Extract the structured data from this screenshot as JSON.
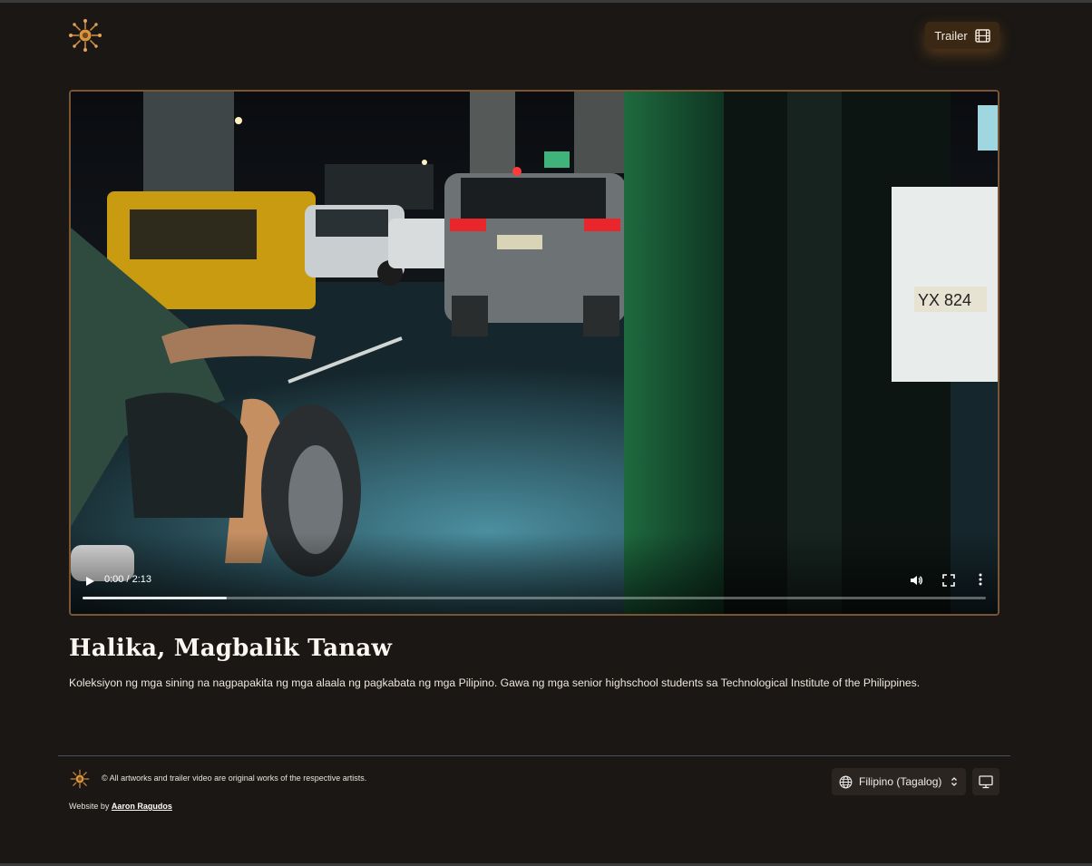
{
  "header": {
    "trailer_label": "Trailer",
    "icons": {
      "logo": "sun-logo-icon",
      "trailer": "film-icon"
    }
  },
  "video": {
    "time_display": "0:00 / 2:13",
    "progress_fraction": 0.16,
    "icons": [
      "play-icon",
      "volume-icon",
      "fullscreen-icon",
      "more-vertical-icon"
    ]
  },
  "main": {
    "title": "Halika, Magbalik Tanaw",
    "description": "Koleksiyon ng mga sining na nagpapakita ng mga alaala ng pagkabata ng mga Pilipino. Gawa ng mga senior highschool students sa Technological Institute of the Philippines."
  },
  "footer": {
    "copyright": "© All artworks and trailer video are original works of the respective artists.",
    "credit_prefix": "Website by",
    "credit_name": "Aaron Ragudos",
    "language": "Filipino (Tagalog)",
    "icons": [
      "globe-icon",
      "chevron-up-down-icon",
      "monitor-icon"
    ]
  },
  "colors": {
    "background": "#1a1714",
    "accent": "#7a5535",
    "button": "#3a2714"
  }
}
